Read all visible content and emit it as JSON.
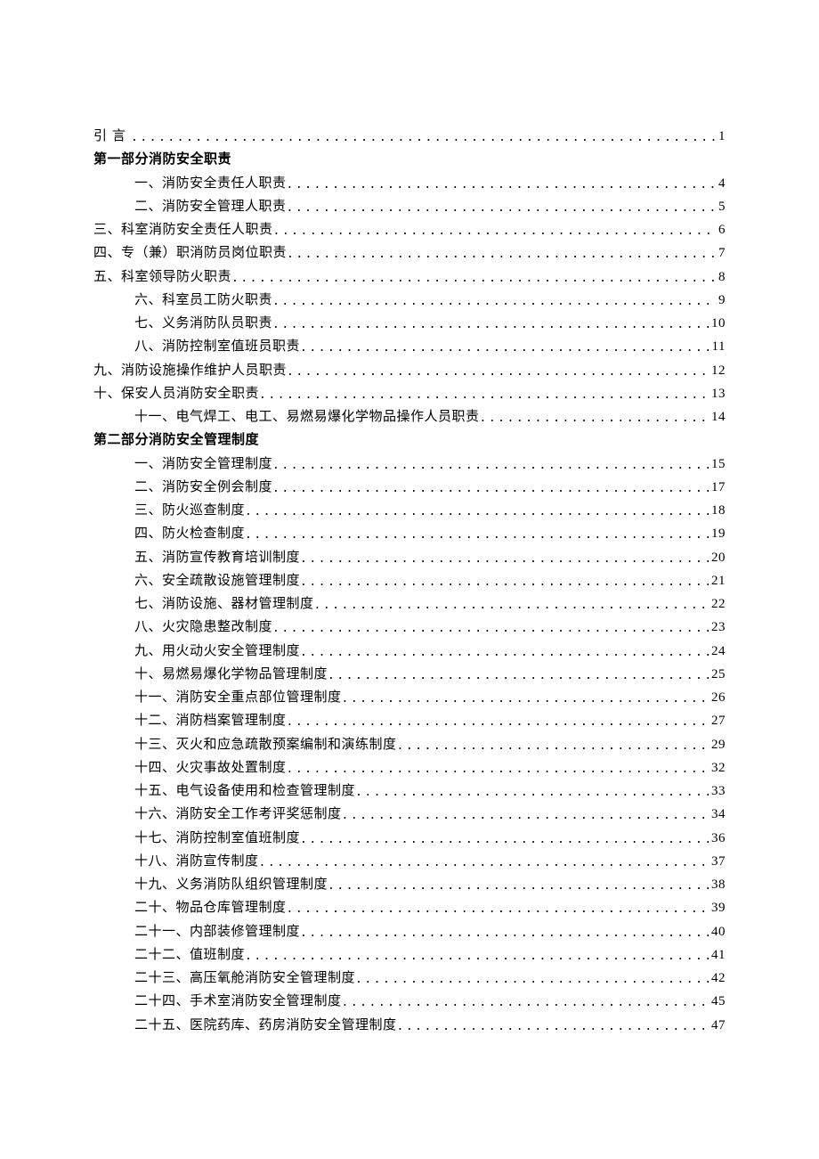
{
  "toc": [
    {
      "label": "引言",
      "page": "1",
      "indent": 0,
      "heading": false,
      "spaced": true
    },
    {
      "label": "第一部分消防安全职责",
      "page": "",
      "indent": 0,
      "heading": true
    },
    {
      "label": "一、消防安全责任人职责",
      "page": "4",
      "indent": 1
    },
    {
      "label": "二、消防安全管理人职责",
      "page": "5",
      "indent": 1
    },
    {
      "label": "三、科室消防安全责任人职责",
      "page": "6",
      "indent": 0
    },
    {
      "label": "四、专（兼）职消防员岗位职责",
      "page": "7",
      "indent": 0
    },
    {
      "label": "五、科室领导防火职责",
      "page": "8",
      "indent": 0
    },
    {
      "label": "六、科室员工防火职责",
      "page": "9",
      "indent": 1
    },
    {
      "label": "七、义务消防队员职责",
      "page": "10",
      "indent": 1
    },
    {
      "label": "八、消防控制室值班员职责",
      "page": "11",
      "indent": 1
    },
    {
      "label": "九、消防设施操作维护人员职责",
      "page": "12",
      "indent": 0
    },
    {
      "label": "十、保安人员消防安全职责",
      "page": "13",
      "indent": 0
    },
    {
      "label": "十一、电气焊工、电工、易燃易爆化学物品操作人员职责",
      "page": "14",
      "indent": 1
    },
    {
      "label": "第二部分消防安全管理制度",
      "page": "",
      "indent": 0,
      "heading": true
    },
    {
      "label": "一、消防安全管理制度",
      "page": "15",
      "indent": 1
    },
    {
      "label": "二、消防安全例会制度",
      "page": "17",
      "indent": 1
    },
    {
      "label": "三、防火巡查制度",
      "page": "18",
      "indent": 1
    },
    {
      "label": "四、防火检查制度",
      "page": "19",
      "indent": 1
    },
    {
      "label": "五、消防宣传教育培训制度",
      "page": "20",
      "indent": 1
    },
    {
      "label": "六、安全疏散设施管理制度",
      "page": "21",
      "indent": 1
    },
    {
      "label": "七、消防设施、器材管理制度",
      "page": "22",
      "indent": 1
    },
    {
      "label": "八、火灾隐患整改制度",
      "page": "23",
      "indent": 1
    },
    {
      "label": "九、用火动火安全管理制度",
      "page": "24",
      "indent": 1
    },
    {
      "label": "十、易燃易爆化学物品管理制度",
      "page": "25",
      "indent": 1
    },
    {
      "label": "十一、消防安全重点部位管理制度",
      "page": "26",
      "indent": 1
    },
    {
      "label": "十二、消防档案管理制度",
      "page": "27",
      "indent": 1
    },
    {
      "label": "十三、灭火和应急疏散预案编制和演练制度",
      "page": "29",
      "indent": 1
    },
    {
      "label": "十四、火灾事故处置制度",
      "page": "32",
      "indent": 1
    },
    {
      "label": "十五、电气设备使用和检查管理制度",
      "page": "33",
      "indent": 1
    },
    {
      "label": "十六、消防安全工作考评奖惩制度",
      "page": "34",
      "indent": 1
    },
    {
      "label": "十七、消防控制室值班制度",
      "page": "36",
      "indent": 1
    },
    {
      "label": "十八、消防宣传制度",
      "page": "37",
      "indent": 1
    },
    {
      "label": "十九、义务消防队组织管理制度",
      "page": "38",
      "indent": 1
    },
    {
      "label": "二十、物品仓库管理制度",
      "page": "39",
      "indent": 1
    },
    {
      "label": "二十一、内部装修管理制度",
      "page": "40",
      "indent": 1
    },
    {
      "label": "二十二、值班制度",
      "page": "41",
      "indent": 1
    },
    {
      "label": "二十三、高压氧舱消防安全管理制度",
      "page": "42",
      "indent": 1
    },
    {
      "label": "二十四、手术室消防安全管理制度",
      "page": "45",
      "indent": 1
    },
    {
      "label": "二十五、医院药库、药房消防安全管理制度",
      "page": "47",
      "indent": 1
    }
  ]
}
